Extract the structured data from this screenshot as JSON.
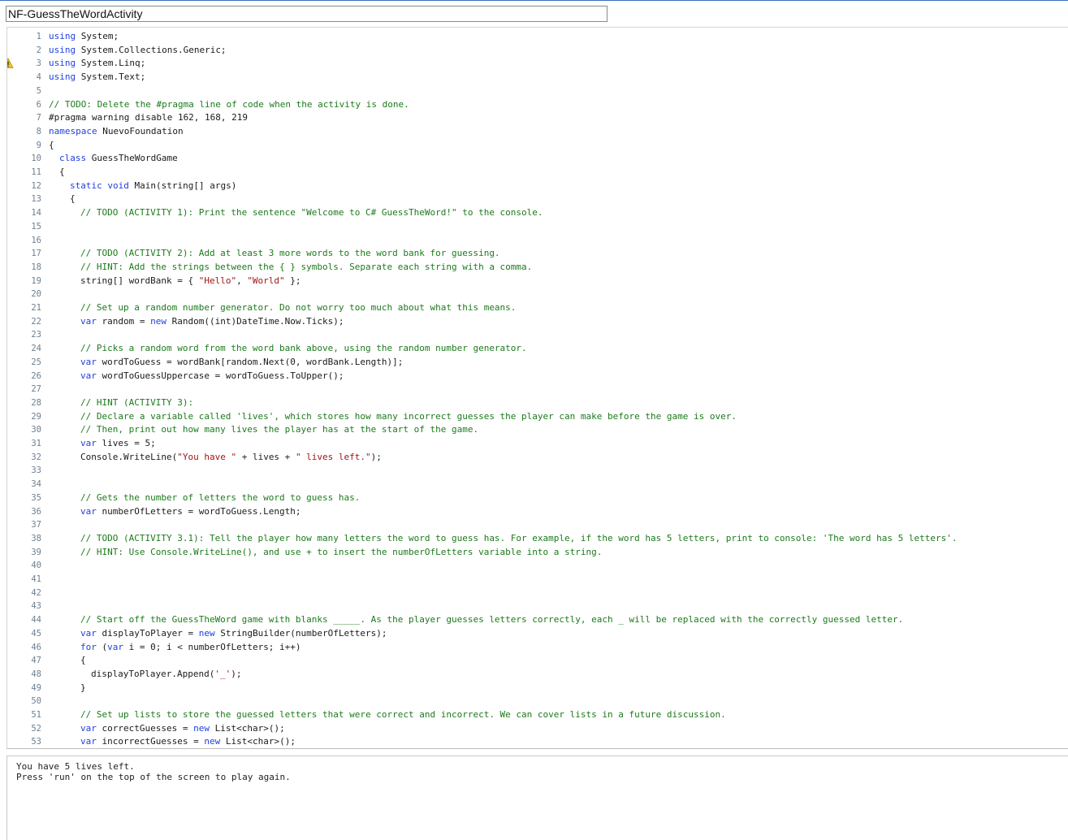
{
  "window": {
    "title": "NF-GuessTheWordActivity"
  },
  "editor": {
    "warning_line": 3,
    "lines": [
      {
        "n": "1",
        "indent": 0,
        "tokens": [
          [
            "kw",
            "using"
          ],
          [
            "",
            "System;"
          ]
        ]
      },
      {
        "n": "2",
        "indent": 0,
        "tokens": [
          [
            "kw",
            "using"
          ],
          [
            "",
            "System.Collections.Generic;"
          ]
        ]
      },
      {
        "n": "3",
        "indent": 0,
        "tokens": [
          [
            "kw",
            "using"
          ],
          [
            "",
            "System.Linq;"
          ]
        ]
      },
      {
        "n": "4",
        "indent": 0,
        "tokens": [
          [
            "kw",
            "using"
          ],
          [
            "",
            "System.Text;"
          ]
        ]
      },
      {
        "n": "5",
        "indent": 0,
        "tokens": []
      },
      {
        "n": "6",
        "indent": 0,
        "tokens": [
          [
            "cm",
            "// TODO: Delete the #pragma line of code when the activity is done."
          ]
        ]
      },
      {
        "n": "7",
        "indent": 0,
        "tokens": [
          [
            "",
            "#pragma warning disable 162, 168, 219"
          ]
        ]
      },
      {
        "n": "8",
        "indent": 0,
        "tokens": [
          [
            "kw",
            "namespace"
          ],
          [
            "",
            "NuevoFoundation"
          ]
        ]
      },
      {
        "n": "9",
        "indent": 0,
        "tokens": [
          [
            "",
            "{"
          ]
        ]
      },
      {
        "n": "10",
        "indent": 1,
        "tokens": [
          [
            "kw",
            "class"
          ],
          [
            "",
            "GuessTheWordGame"
          ]
        ]
      },
      {
        "n": "11",
        "indent": 1,
        "tokens": [
          [
            "",
            "{"
          ]
        ]
      },
      {
        "n": "12",
        "indent": 2,
        "tokens": [
          [
            "kw",
            "static void"
          ],
          [
            "",
            "Main(string[] args)"
          ]
        ]
      },
      {
        "n": "13",
        "indent": 2,
        "tokens": [
          [
            "",
            "{"
          ]
        ]
      },
      {
        "n": "14",
        "indent": 3,
        "tokens": [
          [
            "cm",
            "// TODO (ACTIVITY 1): Print the sentence \"Welcome to C# GuessTheWord!\" to the console."
          ]
        ]
      },
      {
        "n": "15",
        "indent": 0,
        "tokens": []
      },
      {
        "n": "16",
        "indent": 0,
        "tokens": []
      },
      {
        "n": "17",
        "indent": 3,
        "tokens": [
          [
            "cm",
            "// TODO (ACTIVITY 2): Add at least 3 more words to the word bank for guessing."
          ]
        ]
      },
      {
        "n": "18",
        "indent": 3,
        "tokens": [
          [
            "cm",
            "// HINT: Add the strings between the { } symbols. Separate each string with a comma."
          ]
        ]
      },
      {
        "n": "19",
        "indent": 3,
        "tokens": [
          [
            "",
            "string[] wordBank = { "
          ],
          [
            "st",
            "\"Hello\""
          ],
          [
            "",
            ", "
          ],
          [
            "st",
            "\"World\""
          ],
          [
            "",
            " };"
          ]
        ]
      },
      {
        "n": "20",
        "indent": 0,
        "tokens": []
      },
      {
        "n": "21",
        "indent": 3,
        "tokens": [
          [
            "cm",
            "// Set up a random number generator. Do not worry too much about what this means."
          ]
        ]
      },
      {
        "n": "22",
        "indent": 3,
        "tokens": [
          [
            "kw",
            "var"
          ],
          [
            "",
            "random = "
          ],
          [
            "kw",
            "new"
          ],
          [
            "",
            "Random((int)DateTime.Now.Ticks);"
          ]
        ]
      },
      {
        "n": "23",
        "indent": 0,
        "tokens": []
      },
      {
        "n": "24",
        "indent": 3,
        "tokens": [
          [
            "cm",
            "// Picks a random word from the word bank above, using the random number generator."
          ]
        ]
      },
      {
        "n": "25",
        "indent": 3,
        "tokens": [
          [
            "kw",
            "var"
          ],
          [
            "",
            "wordToGuess = wordBank[random.Next(0, wordBank.Length)];"
          ]
        ]
      },
      {
        "n": "26",
        "indent": 3,
        "tokens": [
          [
            "kw",
            "var"
          ],
          [
            "",
            "wordToGuessUppercase = wordToGuess.ToUpper();"
          ]
        ]
      },
      {
        "n": "27",
        "indent": 0,
        "tokens": []
      },
      {
        "n": "28",
        "indent": 3,
        "tokens": [
          [
            "cm",
            "// HINT (ACTIVITY 3):"
          ]
        ]
      },
      {
        "n": "29",
        "indent": 3,
        "tokens": [
          [
            "cm",
            "// Declare a variable called 'lives', which stores how many incorrect guesses the player can make before the game is over."
          ]
        ]
      },
      {
        "n": "30",
        "indent": 3,
        "tokens": [
          [
            "cm",
            "// Then, print out how many lives the player has at the start of the game."
          ]
        ]
      },
      {
        "n": "31",
        "indent": 3,
        "tokens": [
          [
            "kw",
            "var"
          ],
          [
            "",
            "lives = 5;"
          ]
        ]
      },
      {
        "n": "32",
        "indent": 3,
        "tokens": [
          [
            "",
            "Console.WriteLine("
          ],
          [
            "st",
            "\"You have \""
          ],
          [
            "",
            " + lives + "
          ],
          [
            "st",
            "\" lives left.\""
          ],
          [
            "",
            ");"
          ]
        ]
      },
      {
        "n": "33",
        "indent": 0,
        "tokens": []
      },
      {
        "n": "34",
        "indent": 0,
        "tokens": []
      },
      {
        "n": "35",
        "indent": 3,
        "tokens": [
          [
            "cm",
            "// Gets the number of letters the word to guess has."
          ]
        ]
      },
      {
        "n": "36",
        "indent": 3,
        "tokens": [
          [
            "kw",
            "var"
          ],
          [
            "",
            "numberOfLetters = wordToGuess.Length;"
          ]
        ]
      },
      {
        "n": "37",
        "indent": 0,
        "tokens": []
      },
      {
        "n": "38",
        "indent": 3,
        "tokens": [
          [
            "cm",
            "// TODO (ACTIVITY 3.1): Tell the player how many letters the word to guess has. For example, if the word has 5 letters, print to console: 'The word has 5 letters'."
          ]
        ]
      },
      {
        "n": "39",
        "indent": 3,
        "tokens": [
          [
            "cm",
            "// HINT: Use Console.WriteLine(), and use + to insert the numberOfLetters variable into a string."
          ]
        ]
      },
      {
        "n": "40",
        "indent": 0,
        "tokens": []
      },
      {
        "n": "41",
        "indent": 0,
        "tokens": []
      },
      {
        "n": "42",
        "indent": 0,
        "tokens": []
      },
      {
        "n": "43",
        "indent": 0,
        "tokens": []
      },
      {
        "n": "44",
        "indent": 3,
        "tokens": [
          [
            "cm",
            "// Start off the GuessTheWord game with blanks _____. As the player guesses letters correctly, each _ will be replaced with the correctly guessed letter."
          ]
        ]
      },
      {
        "n": "45",
        "indent": 3,
        "tokens": [
          [
            "kw",
            "var"
          ],
          [
            "",
            "displayToPlayer = "
          ],
          [
            "kw",
            "new"
          ],
          [
            "",
            "StringBuilder(numberOfLetters);"
          ]
        ]
      },
      {
        "n": "46",
        "indent": 3,
        "tokens": [
          [
            "kw",
            "for"
          ],
          [
            "",
            "("
          ],
          [
            "kw",
            "var"
          ],
          [
            "",
            "i = 0; i < numberOfLetters; i++)"
          ]
        ]
      },
      {
        "n": "47",
        "indent": 3,
        "tokens": [
          [
            "",
            "{"
          ]
        ]
      },
      {
        "n": "48",
        "indent": 4,
        "tokens": [
          [
            "",
            "displayToPlayer.Append("
          ],
          [
            "st",
            "'_'"
          ],
          [
            "",
            ");"
          ]
        ]
      },
      {
        "n": "49",
        "indent": 3,
        "tokens": [
          [
            "",
            "}"
          ]
        ]
      },
      {
        "n": "50",
        "indent": 0,
        "tokens": []
      },
      {
        "n": "51",
        "indent": 3,
        "tokens": [
          [
            "cm",
            "// Set up lists to store the guessed letters that were correct and incorrect. We can cover lists in a future discussion."
          ]
        ]
      },
      {
        "n": "52",
        "indent": 3,
        "tokens": [
          [
            "kw",
            "var"
          ],
          [
            "",
            "correctGuesses = "
          ],
          [
            "kw",
            "new"
          ],
          [
            "",
            "List<char>();"
          ]
        ]
      },
      {
        "n": "53",
        "indent": 3,
        "tokens": [
          [
            "kw",
            "var"
          ],
          [
            "",
            "incorrectGuesses = "
          ],
          [
            "kw",
            "new"
          ],
          [
            "",
            "List<char>();"
          ]
        ]
      }
    ]
  },
  "console": {
    "lines": [
      "You have 5 lives left.",
      "Press 'run' on the top of the screen to play again."
    ]
  }
}
